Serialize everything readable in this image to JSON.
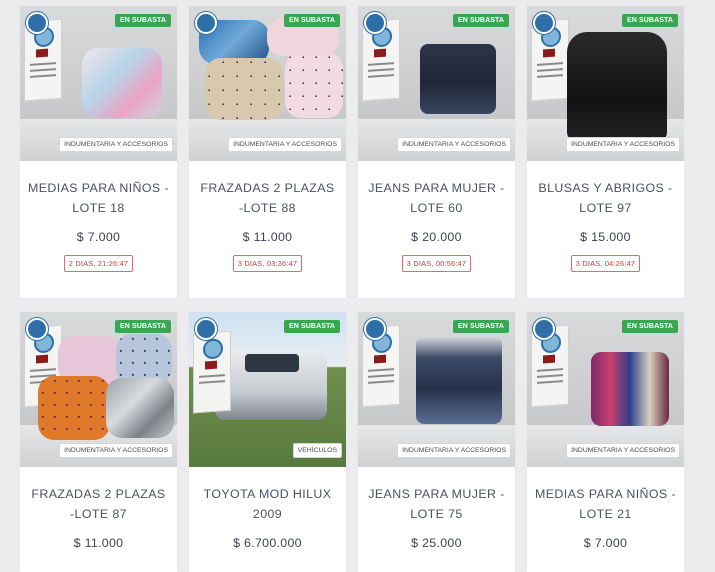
{
  "colors": {
    "badge": "#3aa652",
    "timer": "#d23b3b",
    "title": "#4c4f66"
  },
  "lots": [
    {
      "title": "MEDIAS PARA NIÑOS -LOTE 18",
      "status": "EN SUBASTA",
      "category": "INDUMENTARIA Y ACCESORIOS",
      "price": "$ 7.000",
      "countdown": "2 DIAS, 21:26:47"
    },
    {
      "title": "FRAZADAS 2 PLAZAS -LOTE 88",
      "status": "EN SUBASTA",
      "category": "INDUMENTARIA Y ACCESORIOS",
      "price": "$ 11.000",
      "countdown": "3 DIAS, 03:36:47"
    },
    {
      "title": "JEANS PARA MUJER - LOTE 60",
      "status": "EN SUBASTA",
      "category": "INDUMENTARIA Y ACCESORIOS",
      "price": "$ 20.000",
      "countdown": "3 DIAS, 00:56:47"
    },
    {
      "title": "BLUSAS Y ABRIGOS - LOTE 97",
      "status": "EN SUBASTA",
      "category": "INDUMENTARIA Y ACCESORIOS",
      "price": "$ 15.000",
      "countdown": "3 DIAS, 04:26:47"
    },
    {
      "title": "FRAZADAS 2 PLAZAS -LOTE 87",
      "status": "EN SUBASTA",
      "category": "INDUMENTARIA Y ACCESORIOS",
      "price": "$ 11.000"
    },
    {
      "title": "TOYOTA MOD HILUX 2009",
      "status": "EN SUBASTA",
      "category": "VEHÍCULOS",
      "price": "$ 6.700.000"
    },
    {
      "title": "JEANS PARA MUJER - LOTE 75",
      "status": "EN SUBASTA",
      "category": "INDUMENTARIA Y ACCESORIOS",
      "price": "$ 25.000"
    },
    {
      "title": "MEDIAS PARA NIÑOS -LOTE 21",
      "status": "EN SUBASTA",
      "category": "INDUMENTARIA Y ACCESORIOS",
      "price": "$ 7.000"
    }
  ]
}
